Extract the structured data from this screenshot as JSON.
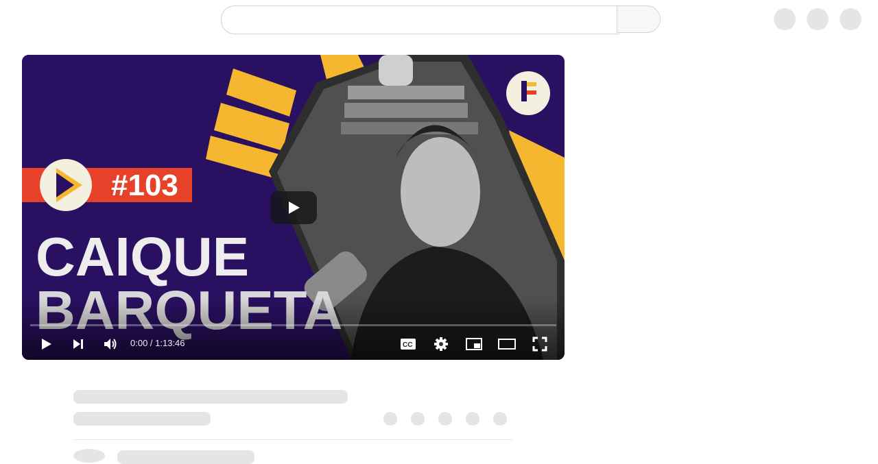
{
  "search": {
    "placeholder": ""
  },
  "video": {
    "episode": "#103",
    "guest_first": "CAIQUE",
    "guest_last": "BARQUETA",
    "time_display": "0:00 / 1:13:46",
    "progress": 0
  },
  "colors": {
    "background_purple": "#2a1060",
    "accent_yellow": "#f5b730",
    "accent_red": "#e8412a"
  },
  "icons": [
    "search-icon",
    "play-icon",
    "next-icon",
    "volume-icon",
    "subtitles-icon",
    "settings-icon",
    "miniplayer-icon",
    "theater-icon",
    "fullscreen-icon"
  ]
}
